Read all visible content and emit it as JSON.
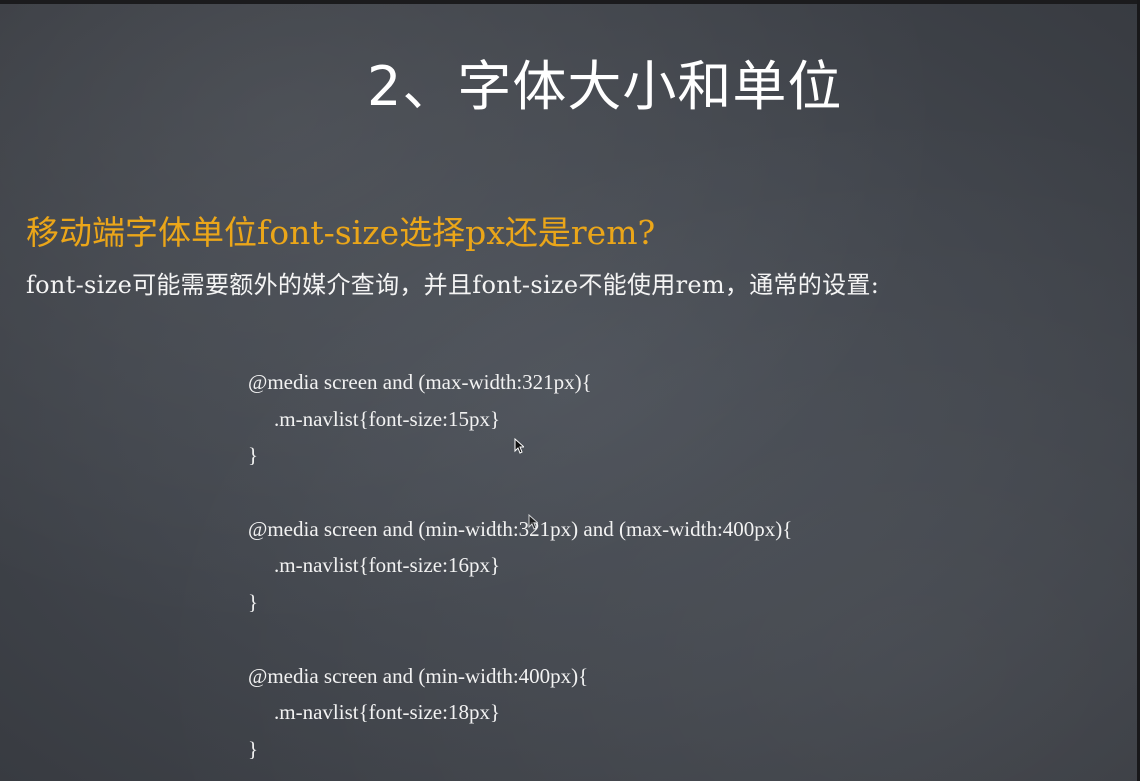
{
  "slide": {
    "title": "2、字体大小和单位",
    "question": "移动端字体单位font-size选择px还是rem?",
    "intro": "font-size可能需要额外的媒介查询，并且font-size不能使用rem，通常的设置:"
  },
  "code": {
    "lines": [
      "@media screen and (max-width:321px){",
      ".m-navlist{font-size:15px}",
      "}",
      "",
      "@media screen and (min-width:321px) and (max-width:400px){",
      ".m-navlist{font-size:16px}",
      "}",
      "",
      "@media screen and (min-width:400px){",
      ".m-navlist{font-size:18px}",
      "}"
    ]
  },
  "icons": {
    "mouse_cursor": "mouse-pointer-icon"
  },
  "colors": {
    "background": "#43474e",
    "title": "#ffffff",
    "question": "#eba619",
    "body_text": "#f4f4f4"
  }
}
